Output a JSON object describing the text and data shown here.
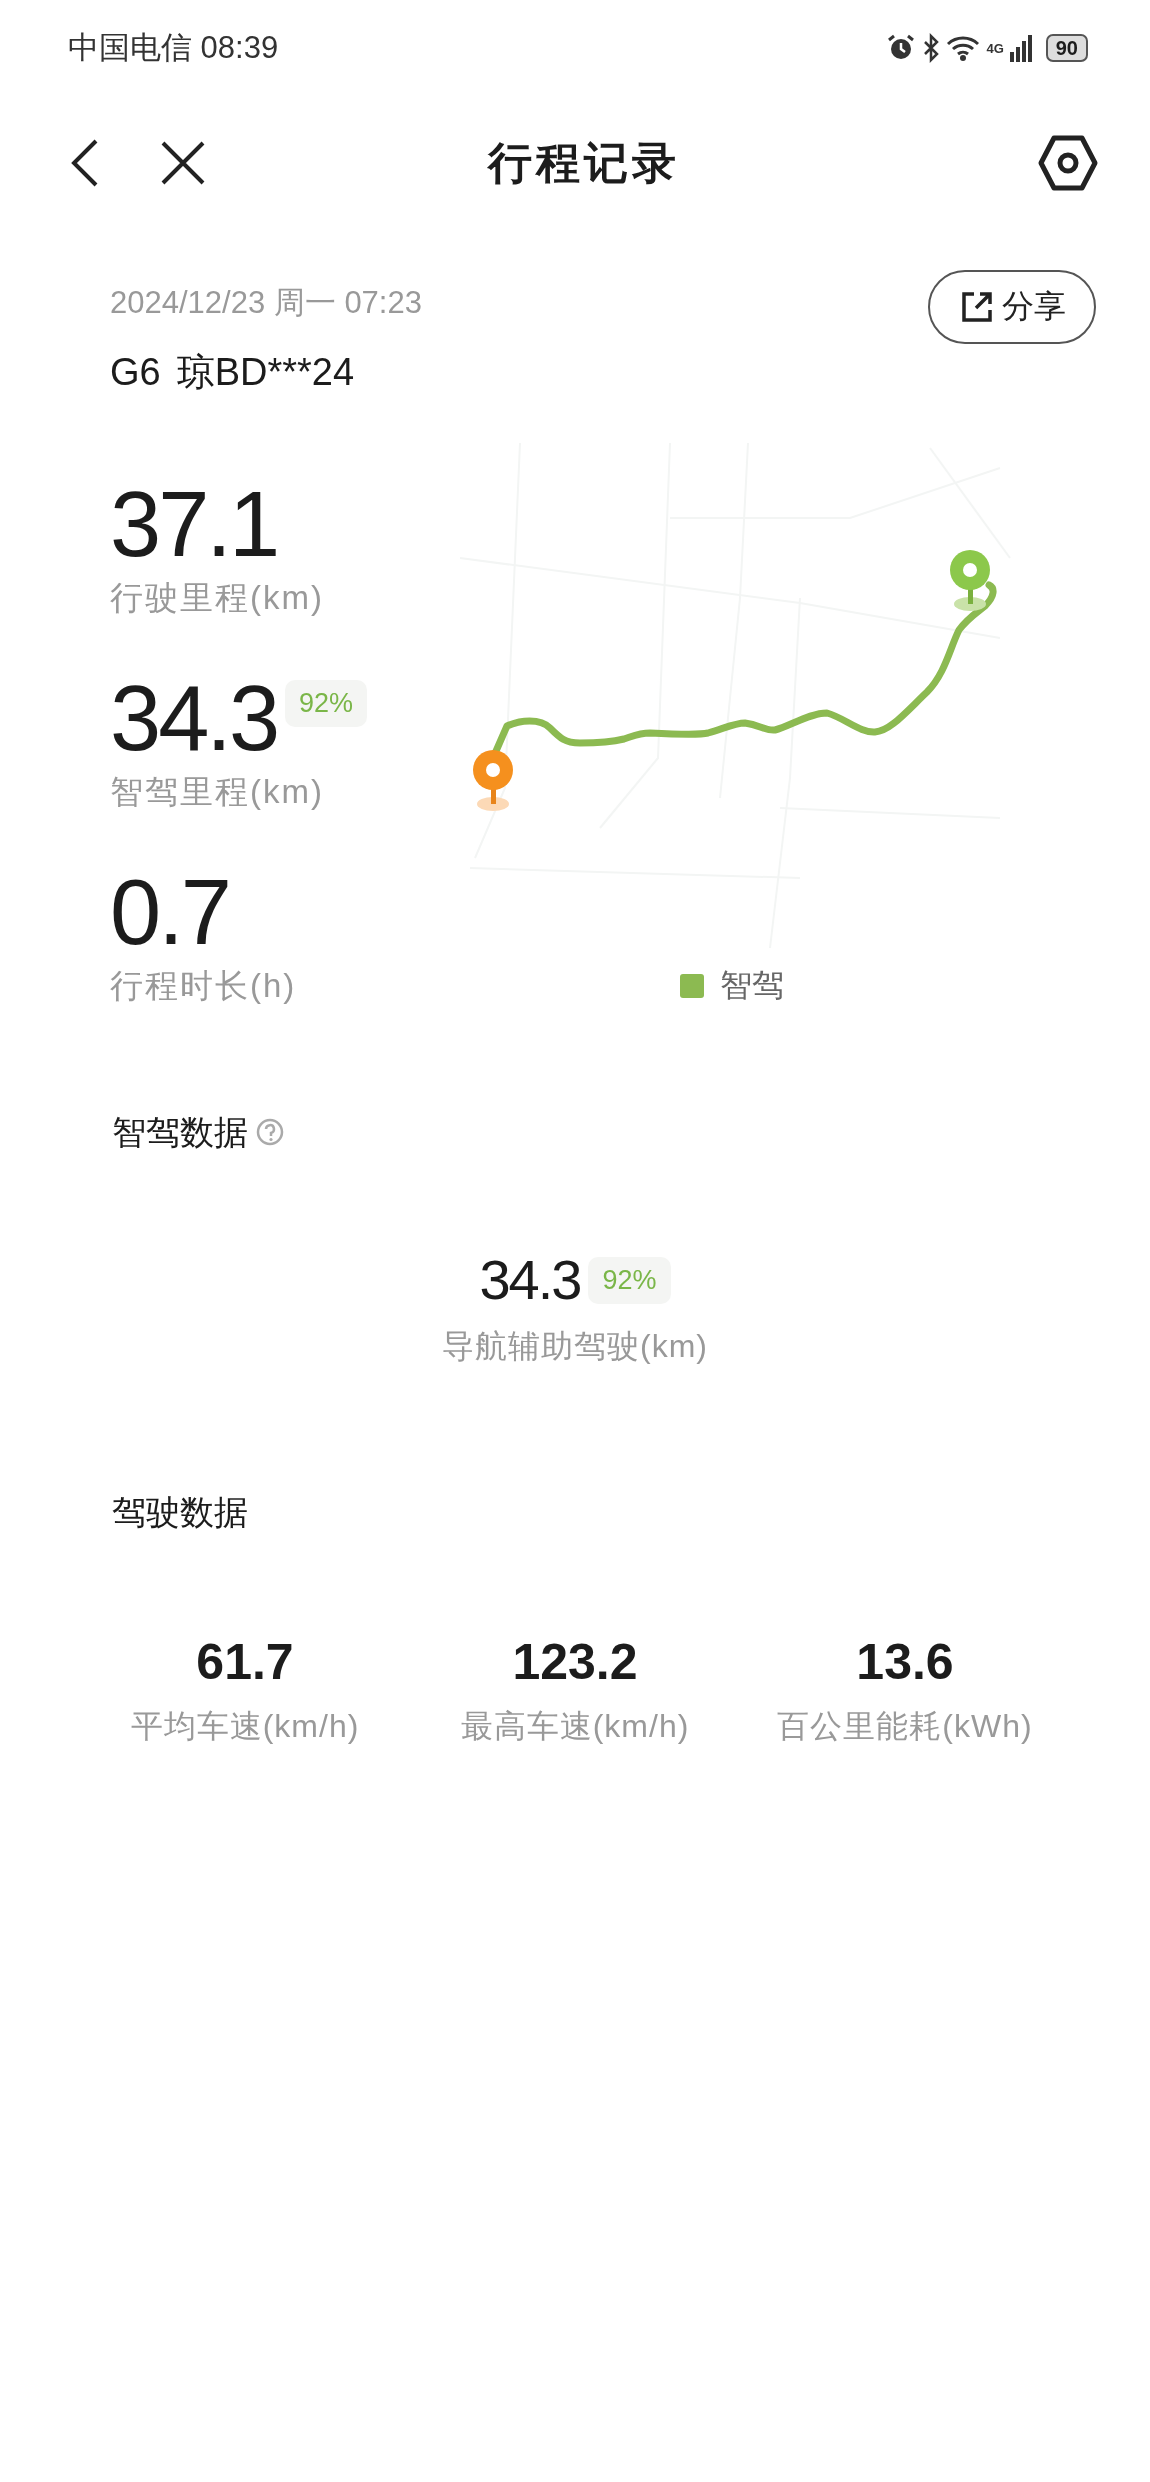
{
  "status_bar": {
    "carrier_time": "中国电信 08:39",
    "network": "4G",
    "battery": "90"
  },
  "header": {
    "title": "行程记录"
  },
  "trip": {
    "datetime": "2024/12/23 周一 07:23",
    "share": "分享",
    "model": "G6",
    "plate": "琼BD***24"
  },
  "stats": [
    {
      "value": "37.1",
      "label": "行驶里程(km)"
    },
    {
      "value": "34.3",
      "badge": "92%",
      "label": "智驾里程(km)"
    },
    {
      "value": "0.7",
      "label": "行程时长(h)"
    }
  ],
  "legend": [
    {
      "label": "智驾",
      "color": "#8cba51"
    }
  ],
  "smart_driving": {
    "title": "智驾数据",
    "value": "34.3",
    "badge": "92%",
    "label": "导航辅助驾驶(km)"
  },
  "driving_data": {
    "title": "驾驶数据",
    "metrics": [
      {
        "value": "61.7",
        "label": "平均车速(km/h)"
      },
      {
        "value": "123.2",
        "label": "最高车速(km/h)"
      },
      {
        "value": "13.6",
        "label": "百公里能耗(kWh)"
      }
    ]
  }
}
